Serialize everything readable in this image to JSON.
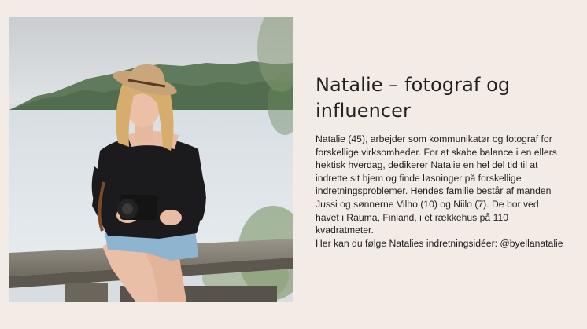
{
  "image": {
    "alt": "",
    "icon": "photo-icon"
  },
  "article": {
    "heading": "Natalie – fotograf og influencer",
    "body": "Natalie (45), arbejder som kommunikatør og fotograf for forskellige virksomheder. For at skabe balance i en ellers hektisk hverdag, dedikerer Natalie en hel del tid til at indrette sit hjem og finde løsninger på forskellige indretningsproblemer. Hendes familie består af manden Jussi og sønnerne Vilho (10) og Niilo (7). De bor ved havet i Rauma, Finland, i et rækkehus på 110 kvadratmeter.",
    "follow": "Her kan du følge Natalies indretningsidéer: @byellanatalie"
  },
  "colors": {
    "background": "#f3ebe6",
    "text": "#222222"
  }
}
